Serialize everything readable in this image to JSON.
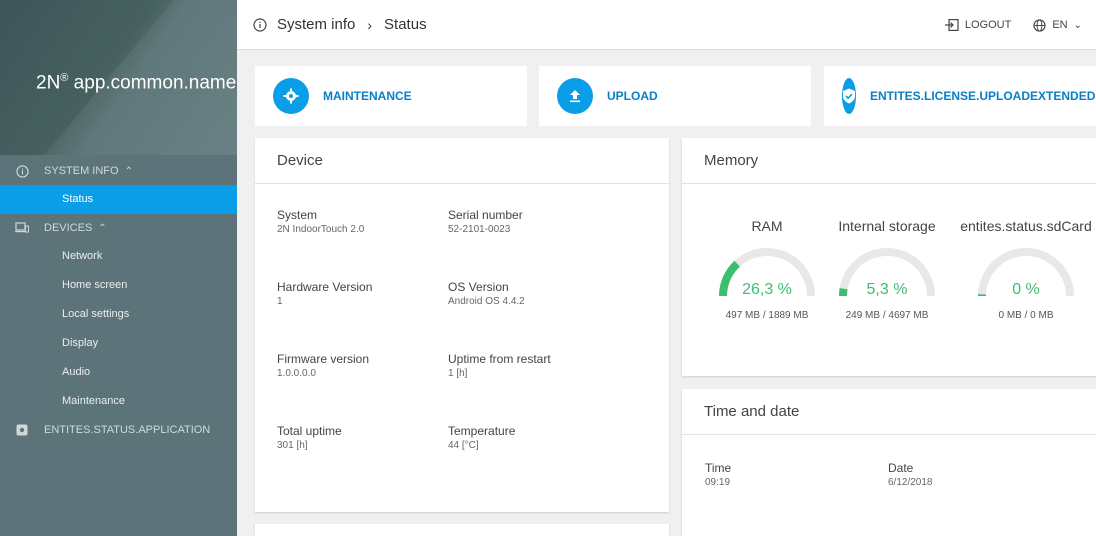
{
  "sidebar": {
    "brand": {
      "prefix": "2N",
      "reg": "®",
      "name": " app.common.name"
    },
    "groups": [
      {
        "label": "SYSTEM INFO",
        "items": [
          {
            "label": "Status",
            "active": true
          }
        ]
      },
      {
        "label": "DEVICES",
        "items": [
          {
            "label": "Network"
          },
          {
            "label": "Home screen"
          },
          {
            "label": "Local settings"
          },
          {
            "label": "Display"
          },
          {
            "label": "Audio"
          },
          {
            "label": "Maintenance"
          }
        ]
      },
      {
        "label": "ENTITES.STATUS.APPLICATION",
        "items": []
      }
    ]
  },
  "header": {
    "breadcrumb": [
      "System info",
      "Status"
    ],
    "logout": "LOGOUT",
    "language": "EN"
  },
  "actions": [
    {
      "label": "MAINTENANCE",
      "icon": "gear-icon"
    },
    {
      "label": "UPLOAD",
      "icon": "upload-icon"
    },
    {
      "label": "ENTITES.LICENSE.UPLOADEXTENDEDI",
      "icon": "shield-check-icon"
    }
  ],
  "device": {
    "title": "Device",
    "fields": [
      {
        "label": "System",
        "value": "2N IndoorTouch 2.0"
      },
      {
        "label": "Serial number",
        "value": "52-2101-0023"
      },
      {
        "label": "Hardware Version",
        "value": "1"
      },
      {
        "label": "OS Version",
        "value": "Android OS 4.4.2"
      },
      {
        "label": "Firmware version",
        "value": "1.0.0.0.0"
      },
      {
        "label": "Uptime from restart",
        "value": "1 [h]"
      },
      {
        "label": "Total uptime",
        "value": "301 [h]"
      },
      {
        "label": "Temperature",
        "value": "44 [°C]"
      }
    ]
  },
  "memory": {
    "title": "Memory",
    "gauges": [
      {
        "label": "RAM",
        "percent_text": "26,3 %",
        "fraction": 0.263,
        "usage": "497 MB / 1889 MB"
      },
      {
        "label": "Internal storage",
        "percent_text": "5,3 %",
        "fraction": 0.053,
        "usage": "249 MB / 4697 MB"
      },
      {
        "label": "entites.status.sdCard",
        "percent_text": "0 %",
        "fraction": 0.0,
        "usage": "0 MB / 0 MB"
      }
    ],
    "colors": {
      "accent": "#3bbf6e",
      "track": "#e8e8e8"
    }
  },
  "timedate": {
    "title": "Time and date",
    "time_label": "Time",
    "time_value": "09:19",
    "date_label": "Date",
    "date_value": "6/12/2018"
  },
  "colors": {
    "primary": "#0a9ee8",
    "sidebar": "#5c7479"
  }
}
